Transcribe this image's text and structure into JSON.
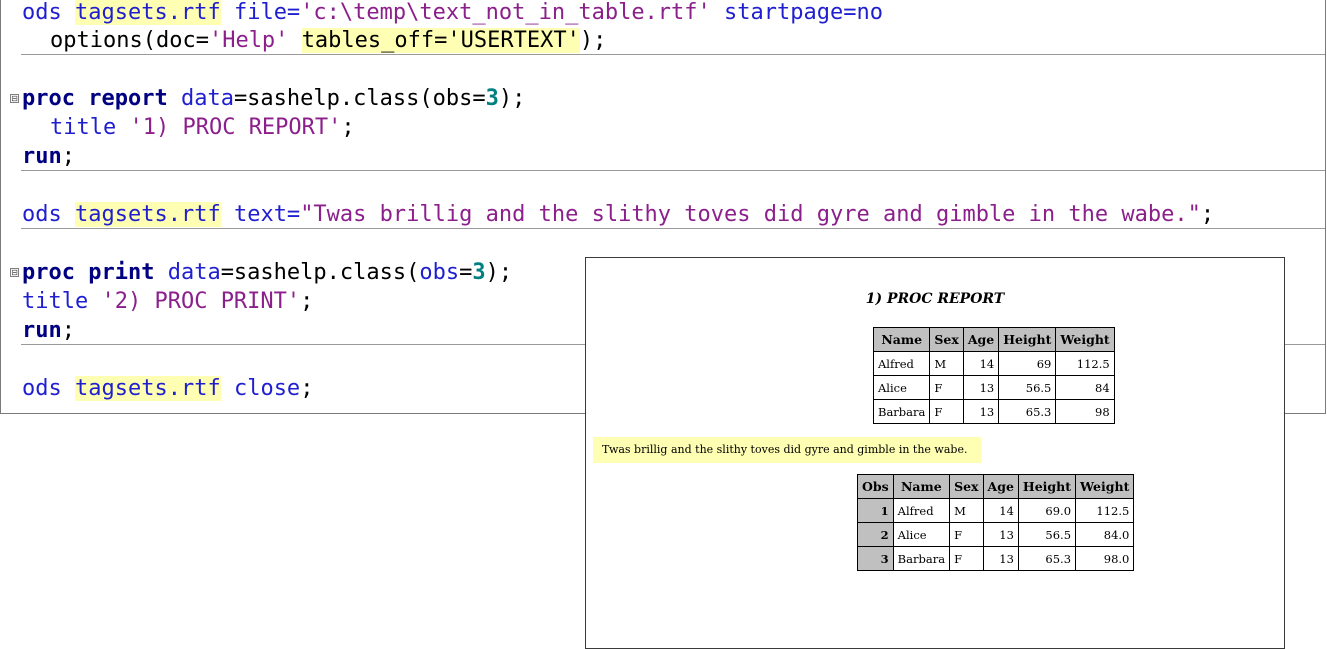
{
  "editor": {
    "line1": {
      "kw1": "ods",
      "tagset": "tagsets.rtf",
      "file_kw": "file=",
      "file_val": "'c:\\temp\\text_not_in_table.rtf'",
      "startpage": "startpage=no"
    },
    "line2": {
      "func": "options(doc=",
      "doc_val": "'Help'",
      "tables_off": "tables_off='USERTEXT'",
      "close": ");"
    },
    "line3": {
      "proc": "proc report",
      "data_kw": "data",
      "data_val": "=sashelp.class(obs=",
      "obs": "3",
      "end": ");"
    },
    "line4": {
      "title_kw": "title",
      "title_val": "'1) PROC REPORT'",
      "semi": ";"
    },
    "line5": {
      "run": "run",
      "semi": ";"
    },
    "line6": {
      "kw1": "ods",
      "tagset": "tagsets.rtf",
      "text_kw": "text=",
      "text_val": "\"Twas brillig and the slithy toves did gyre and gimble in the wabe.\"",
      "semi": ";"
    },
    "line7": {
      "proc": "proc print",
      "data_kw": "data",
      "data_val": "=sashelp.class(",
      "obs_kw": "obs",
      "eq": "=",
      "obs": "3",
      "end": ");"
    },
    "line8": {
      "title_kw": "title",
      "title_val": "'2) PROC PRINT'",
      "semi": ";"
    },
    "line9": {
      "run": "run",
      "semi": ";"
    },
    "line10": {
      "kw1": "ods",
      "tagset": "tagsets.rtf",
      "close_kw": "close",
      "semi": ";"
    },
    "fold_icon": "⊟"
  },
  "output": {
    "title": "1) PROC REPORT",
    "report_table": {
      "headers": [
        "Name",
        "Sex",
        "Age",
        "Height",
        "Weight"
      ],
      "rows": [
        [
          "Alfred",
          "M",
          "14",
          "69",
          "112.5"
        ],
        [
          "Alice",
          "F",
          "13",
          "56.5",
          "84"
        ],
        [
          "Barbara",
          "F",
          "13",
          "65.3",
          "98"
        ]
      ]
    },
    "text": "Twas brillig and the slithy toves did gyre and gimble in the wabe.",
    "print_table": {
      "headers": [
        "Obs",
        "Name",
        "Sex",
        "Age",
        "Height",
        "Weight"
      ],
      "rows": [
        [
          "1",
          "Alfred",
          "M",
          "14",
          "69.0",
          "112.5"
        ],
        [
          "2",
          "Alice",
          "F",
          "13",
          "56.5",
          "84.0"
        ],
        [
          "3",
          "Barbara",
          "F",
          "13",
          "65.3",
          "98.0"
        ]
      ]
    }
  }
}
